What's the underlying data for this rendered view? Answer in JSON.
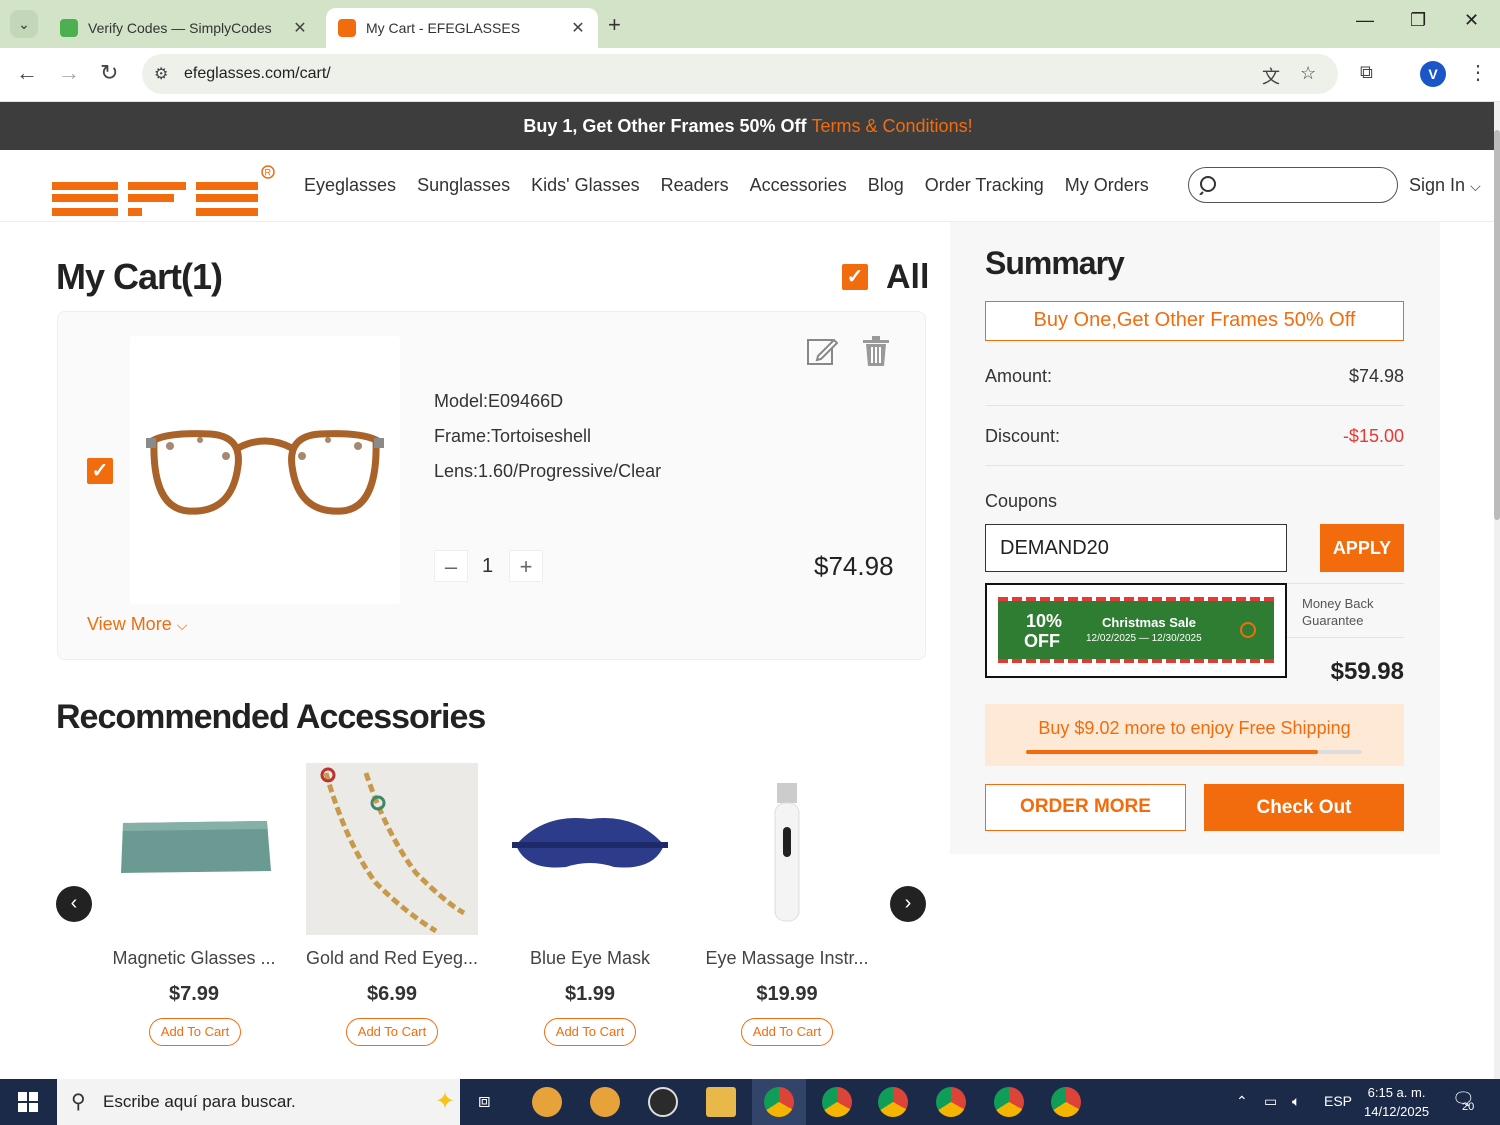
{
  "browser": {
    "tabs": [
      {
        "title": "Verify Codes — SimplyCodes",
        "active": false
      },
      {
        "title": "My Cart - EFEGLASSES",
        "active": true
      }
    ],
    "url": "efeglasses.com/cart/"
  },
  "promo_bar": {
    "text": "Buy 1, Get Other Frames 50% Off",
    "link": "Terms & Conditions!"
  },
  "site": {
    "nav": [
      "Eyeglasses",
      "Sunglasses",
      "Kids' Glasses",
      "Readers",
      "Accessories",
      "Blog",
      "Order Tracking",
      "My Orders"
    ],
    "sign_in": "Sign In"
  },
  "cart": {
    "title": "My Cart(1)",
    "select_all": "All",
    "item": {
      "model": "Model:E09466D",
      "frame": "Frame:Tortoiseshell",
      "lens": "Lens:1.60/Progressive/Clear",
      "quantity": "1",
      "price": "$74.98",
      "view_more": "View More"
    }
  },
  "recommended": {
    "title": "Recommended Accessories",
    "items": [
      {
        "name": "Magnetic Glasses ...",
        "price": "$7.99",
        "button": "Add To Cart"
      },
      {
        "name": "Gold and Red Eyeg...",
        "price": "$6.99",
        "button": "Add To Cart"
      },
      {
        "name": "Blue Eye Mask",
        "price": "$1.99",
        "button": "Add To Cart"
      },
      {
        "name": "Eye Massage Instr...",
        "price": "$19.99",
        "button": "Add To Cart"
      }
    ]
  },
  "summary": {
    "title": "Summary",
    "promo_button": "Buy One,Get Other Frames 50% Off",
    "amount_label": "Amount:",
    "amount_value": "$74.98",
    "discount_label": "Discount:",
    "discount_value": "-$15.00",
    "coupons_label": "Coupons",
    "coupon_value": "DEMAND20",
    "apply": "APPLY",
    "coupon_option": {
      "percent": "10%",
      "off": "OFF",
      "name": "Christmas Sale",
      "dates": "12/02/2025 — 12/30/2025"
    },
    "money_back": [
      "Money Back",
      "Guarantee"
    ],
    "total_value": "$59.98",
    "shipping_text": "Buy $9.02 more to enjoy Free Shipping",
    "shipping_progress": 0.87,
    "order_more": "ORDER MORE",
    "checkout": "Check Out"
  },
  "taskbar": {
    "search_placeholder": "Escribe aquí para buscar.",
    "lang": "ESP",
    "time": "6:15 a. m.",
    "date": "14/12/2025",
    "notifications": "20"
  },
  "colors": {
    "accent": "#f26c0d",
    "promo_bg": "#3d3d3d",
    "coupon_green": "#2e7d32",
    "taskbar": "#1c2a4a"
  }
}
